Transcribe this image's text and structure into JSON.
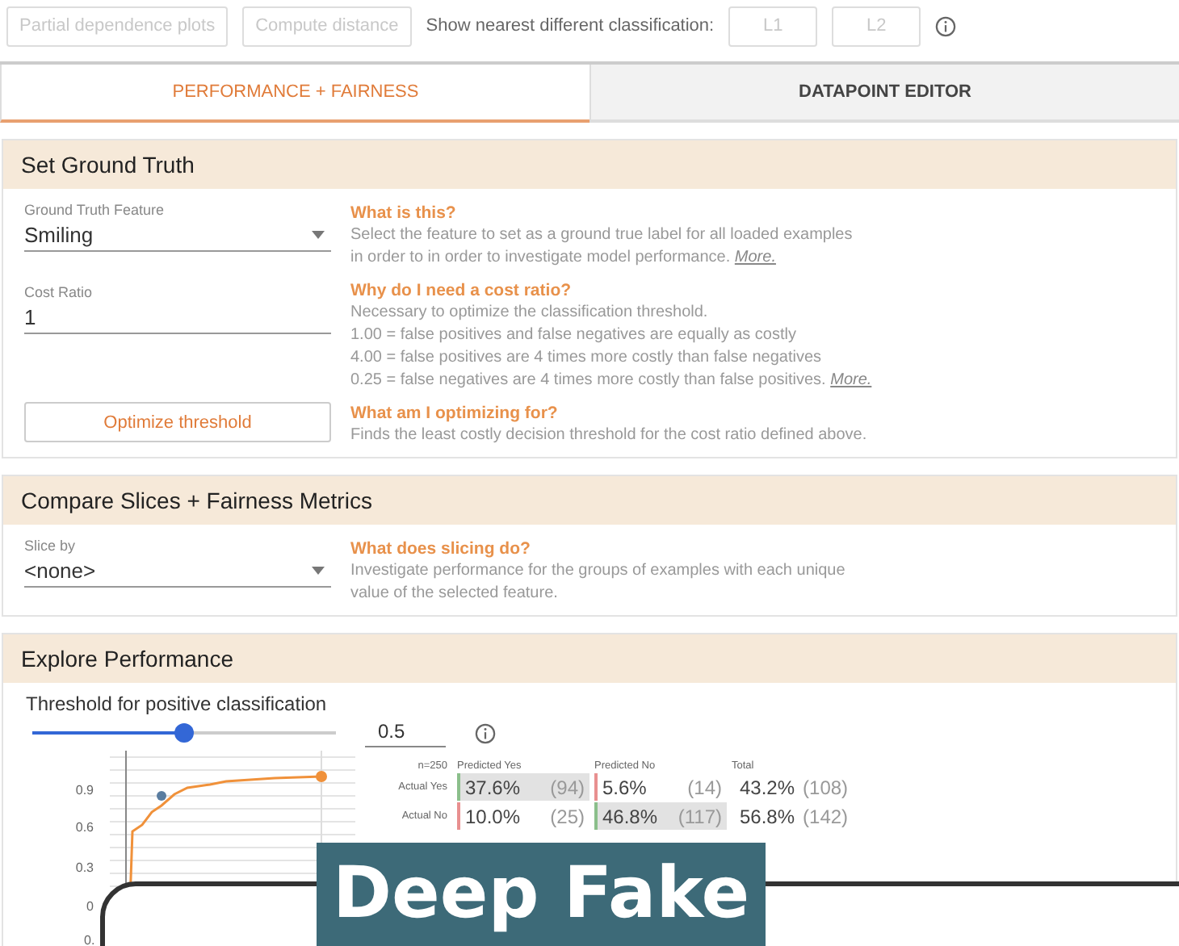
{
  "toolbar": {
    "buttons": [
      {
        "label": "Partial dependence plots",
        "disabled": true
      },
      {
        "label": "Compute distance",
        "disabled": true
      }
    ],
    "nearest_label": "Show nearest different classification:",
    "distance_buttons": [
      {
        "label": "L1",
        "disabled": true
      },
      {
        "label": "L2",
        "disabled": true
      }
    ]
  },
  "tabs": [
    {
      "label": "PERFORMANCE + FAIRNESS",
      "selected": true
    },
    {
      "label": "DATAPOINT EDITOR",
      "selected": false
    }
  ],
  "ground_truth": {
    "title": "Set Ground Truth",
    "feature": {
      "label": "Ground Truth Feature",
      "value": "Smiling"
    },
    "cost_ratio": {
      "label": "Cost Ratio",
      "value": "1"
    },
    "optimize_button": "Optimize threshold",
    "help": [
      {
        "heading": "What is this?",
        "lines": [
          "Select the feature to set as a ground true label for all loaded examples",
          "in order to in order to investigate model performance."
        ],
        "link": "More."
      },
      {
        "heading": "Why do I need a cost ratio?",
        "lines": [
          "Necessary to optimize the classification threshold.",
          "1.00 = false positives and false negatives are equally as costly",
          "4.00 = false positives are 4 times more costly than false negatives",
          "0.25 = false negatives are 4 times more costly than false positives."
        ],
        "link": "More."
      },
      {
        "heading": "What am I optimizing for?",
        "lines": [
          "Finds the least costly decision threshold for the cost ratio defined above."
        ]
      }
    ]
  },
  "slices": {
    "title": "Compare Slices + Fairness Metrics",
    "slice_by": {
      "label": "Slice by",
      "value": "<none>"
    },
    "help": [
      {
        "heading": "What does slicing do?",
        "lines": [
          "Investigate performance for the groups of examples with each unique",
          "value of the selected feature."
        ]
      }
    ]
  },
  "performance": {
    "title": "Explore Performance",
    "threshold": {
      "label": "Threshold for positive classification",
      "level": 0.5,
      "value": "0.5"
    },
    "curve": {
      "y_ticks": [
        "0.9",
        "0.6",
        "0.3",
        "0"
      ],
      "x_tick": "0."
    },
    "matrix": {
      "corner": "n=250",
      "columns": [
        "Predicted Yes",
        "Predicted No",
        "Total"
      ],
      "rows": [
        {
          "label": "Actual Yes",
          "cells": [
            {
              "kind": "correct",
              "pct": "37.6%",
              "count": "(94)"
            },
            {
              "kind": "wrong",
              "pct": "5.6%",
              "count": "(14)"
            },
            {
              "kind": "total",
              "pct": "43.2%",
              "count": "(108)"
            }
          ]
        },
        {
          "label": "Actual No",
          "cells": [
            {
              "kind": "wrong",
              "pct": "10.0%",
              "count": "(25)"
            },
            {
              "kind": "correct",
              "pct": "46.8%",
              "count": "(117)"
            },
            {
              "kind": "total",
              "pct": "56.8%",
              "count": "(142)"
            }
          ]
        }
      ]
    }
  },
  "overlay_title": "Deep Fake"
}
